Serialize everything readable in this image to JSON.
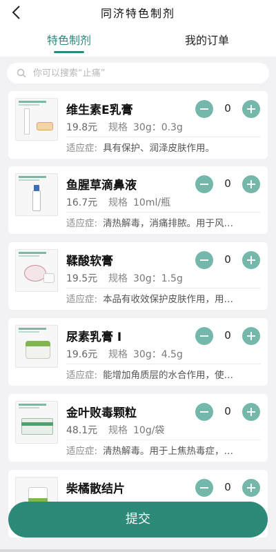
{
  "header": {
    "title": "同济特色制剂",
    "back_icon": "chevron-left-icon"
  },
  "tabs": [
    {
      "label": "特色制剂",
      "active": true
    },
    {
      "label": "我的订单",
      "active": false
    }
  ],
  "search": {
    "placeholder": "你可以搜索“止痛”",
    "icon": "search-icon"
  },
  "products": [
    {
      "name": "维生素E乳膏",
      "price": "19.8元",
      "spec_label": "规格",
      "spec": "30g：0.3g",
      "indication_label": "适应症:",
      "indication": "具有保护、润泽皮肤作用。",
      "quantity": "0"
    },
    {
      "name": "鱼腥草滴鼻液",
      "price": "16.7元",
      "spec_label": "规格",
      "spec": "10ml/瓶",
      "indication_label": "适应症:",
      "indication": "清热解毒，消痛排脓。用于风…",
      "quantity": "0"
    },
    {
      "name": "鞣酸软膏",
      "price": "19.5元",
      "spec_label": "规格",
      "spec": "30g：1.5g",
      "indication_label": "适应症:",
      "indication": "本品有收效保护皮肤作用，用…",
      "quantity": "0"
    },
    {
      "name": "尿素乳膏 I",
      "price": "19.6元",
      "spec_label": "规格",
      "spec": "30g：4.5g",
      "indication_label": "适应症:",
      "indication": "能增加角质层的水合作用，使…",
      "quantity": "0"
    },
    {
      "name": "金叶败毒颗粒",
      "price": "48.1元",
      "spec_label": "规格",
      "spec": "10g/袋",
      "indication_label": "适应症:",
      "indication": "清热解毒。用于上焦热毒症，…",
      "quantity": "0"
    },
    {
      "name": "柴橘散结片",
      "price": "",
      "spec_label": "",
      "spec": "",
      "indication_label": "",
      "indication": "",
      "quantity": "0"
    }
  ],
  "submit": {
    "label": "提交"
  },
  "colors": {
    "accent": "#2d8a79",
    "stepper": "#74b8ab",
    "tab_active": "#2a8a7e"
  }
}
